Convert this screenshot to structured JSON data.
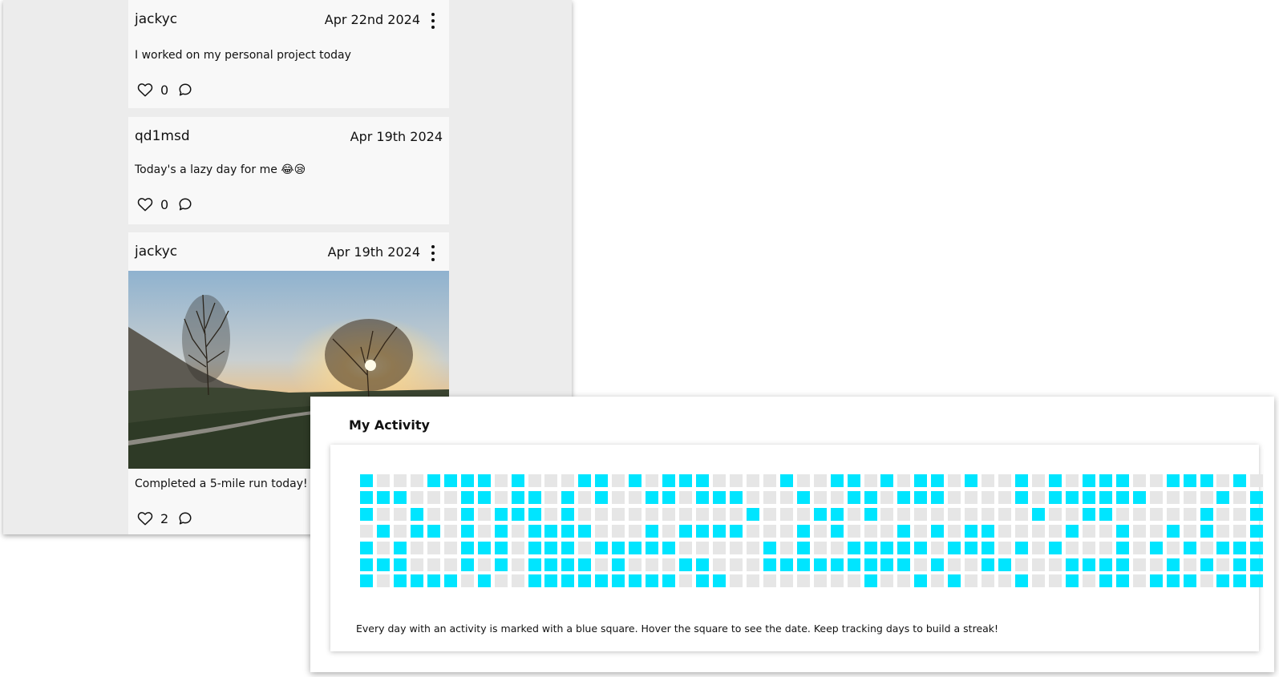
{
  "colors": {
    "active": "#00e5ff",
    "inactive": "#e6e6e6"
  },
  "posts": [
    {
      "username": "jackyc",
      "date": "Apr 22nd 2024",
      "text": "I worked on my personal project today",
      "likes": "0",
      "has_menu": true
    },
    {
      "username": "qd1msd",
      "date": "Apr 19th 2024",
      "text": "Today's a lazy day for me 😂😪",
      "likes": "0",
      "has_menu": false
    },
    {
      "username": "jackyc",
      "date": "Apr 19th 2024",
      "text": "Completed a 5-mile run today!",
      "likes": "2",
      "has_menu": true,
      "image": "photo of two bare trees silhouetted against a sunset over a grassy hill with a winding path"
    }
  ],
  "activity": {
    "title": "My Activity",
    "caption": "Every day with an activity is marked with a blue square. Hover the square to see the date. Keep tracking days to build a streak!",
    "rows": [
      "100011110100011010111000010011010110100101011100111010",
      "111000110110101001101110001001101110000101111110000101",
      "100100101110100000000001000110100000000010011000001001",
      "010110101011110001011110001010001010110000100100101001",
      "101000111011101111100000101001111101110101000101010111",
      "111000101011110100011000111111111010011000111100101011",
      "101111010011111111101100000000100101000100101101110111"
    ]
  }
}
